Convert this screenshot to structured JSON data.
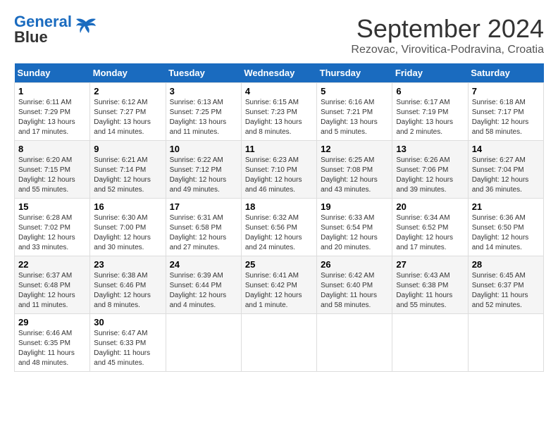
{
  "header": {
    "logo_line1": "General",
    "logo_line2": "Blue",
    "month": "September 2024",
    "location": "Rezovac, Virovitica-Podravina, Croatia"
  },
  "weekdays": [
    "Sunday",
    "Monday",
    "Tuesday",
    "Wednesday",
    "Thursday",
    "Friday",
    "Saturday"
  ],
  "weeks": [
    [
      {
        "day": "1",
        "info": "Sunrise: 6:11 AM\nSunset: 7:29 PM\nDaylight: 13 hours and 17 minutes."
      },
      {
        "day": "2",
        "info": "Sunrise: 6:12 AM\nSunset: 7:27 PM\nDaylight: 13 hours and 14 minutes."
      },
      {
        "day": "3",
        "info": "Sunrise: 6:13 AM\nSunset: 7:25 PM\nDaylight: 13 hours and 11 minutes."
      },
      {
        "day": "4",
        "info": "Sunrise: 6:15 AM\nSunset: 7:23 PM\nDaylight: 13 hours and 8 minutes."
      },
      {
        "day": "5",
        "info": "Sunrise: 6:16 AM\nSunset: 7:21 PM\nDaylight: 13 hours and 5 minutes."
      },
      {
        "day": "6",
        "info": "Sunrise: 6:17 AM\nSunset: 7:19 PM\nDaylight: 13 hours and 2 minutes."
      },
      {
        "day": "7",
        "info": "Sunrise: 6:18 AM\nSunset: 7:17 PM\nDaylight: 12 hours and 58 minutes."
      }
    ],
    [
      {
        "day": "8",
        "info": "Sunrise: 6:20 AM\nSunset: 7:15 PM\nDaylight: 12 hours and 55 minutes."
      },
      {
        "day": "9",
        "info": "Sunrise: 6:21 AM\nSunset: 7:14 PM\nDaylight: 12 hours and 52 minutes."
      },
      {
        "day": "10",
        "info": "Sunrise: 6:22 AM\nSunset: 7:12 PM\nDaylight: 12 hours and 49 minutes."
      },
      {
        "day": "11",
        "info": "Sunrise: 6:23 AM\nSunset: 7:10 PM\nDaylight: 12 hours and 46 minutes."
      },
      {
        "day": "12",
        "info": "Sunrise: 6:25 AM\nSunset: 7:08 PM\nDaylight: 12 hours and 43 minutes."
      },
      {
        "day": "13",
        "info": "Sunrise: 6:26 AM\nSunset: 7:06 PM\nDaylight: 12 hours and 39 minutes."
      },
      {
        "day": "14",
        "info": "Sunrise: 6:27 AM\nSunset: 7:04 PM\nDaylight: 12 hours and 36 minutes."
      }
    ],
    [
      {
        "day": "15",
        "info": "Sunrise: 6:28 AM\nSunset: 7:02 PM\nDaylight: 12 hours and 33 minutes."
      },
      {
        "day": "16",
        "info": "Sunrise: 6:30 AM\nSunset: 7:00 PM\nDaylight: 12 hours and 30 minutes."
      },
      {
        "day": "17",
        "info": "Sunrise: 6:31 AM\nSunset: 6:58 PM\nDaylight: 12 hours and 27 minutes."
      },
      {
        "day": "18",
        "info": "Sunrise: 6:32 AM\nSunset: 6:56 PM\nDaylight: 12 hours and 24 minutes."
      },
      {
        "day": "19",
        "info": "Sunrise: 6:33 AM\nSunset: 6:54 PM\nDaylight: 12 hours and 20 minutes."
      },
      {
        "day": "20",
        "info": "Sunrise: 6:34 AM\nSunset: 6:52 PM\nDaylight: 12 hours and 17 minutes."
      },
      {
        "day": "21",
        "info": "Sunrise: 6:36 AM\nSunset: 6:50 PM\nDaylight: 12 hours and 14 minutes."
      }
    ],
    [
      {
        "day": "22",
        "info": "Sunrise: 6:37 AM\nSunset: 6:48 PM\nDaylight: 12 hours and 11 minutes."
      },
      {
        "day": "23",
        "info": "Sunrise: 6:38 AM\nSunset: 6:46 PM\nDaylight: 12 hours and 8 minutes."
      },
      {
        "day": "24",
        "info": "Sunrise: 6:39 AM\nSunset: 6:44 PM\nDaylight: 12 hours and 4 minutes."
      },
      {
        "day": "25",
        "info": "Sunrise: 6:41 AM\nSunset: 6:42 PM\nDaylight: 12 hours and 1 minute."
      },
      {
        "day": "26",
        "info": "Sunrise: 6:42 AM\nSunset: 6:40 PM\nDaylight: 11 hours and 58 minutes."
      },
      {
        "day": "27",
        "info": "Sunrise: 6:43 AM\nSunset: 6:38 PM\nDaylight: 11 hours and 55 minutes."
      },
      {
        "day": "28",
        "info": "Sunrise: 6:45 AM\nSunset: 6:37 PM\nDaylight: 11 hours and 52 minutes."
      }
    ],
    [
      {
        "day": "29",
        "info": "Sunrise: 6:46 AM\nSunset: 6:35 PM\nDaylight: 11 hours and 48 minutes."
      },
      {
        "day": "30",
        "info": "Sunrise: 6:47 AM\nSunset: 6:33 PM\nDaylight: 11 hours and 45 minutes."
      },
      {
        "day": "",
        "info": ""
      },
      {
        "day": "",
        "info": ""
      },
      {
        "day": "",
        "info": ""
      },
      {
        "day": "",
        "info": ""
      },
      {
        "day": "",
        "info": ""
      }
    ]
  ]
}
